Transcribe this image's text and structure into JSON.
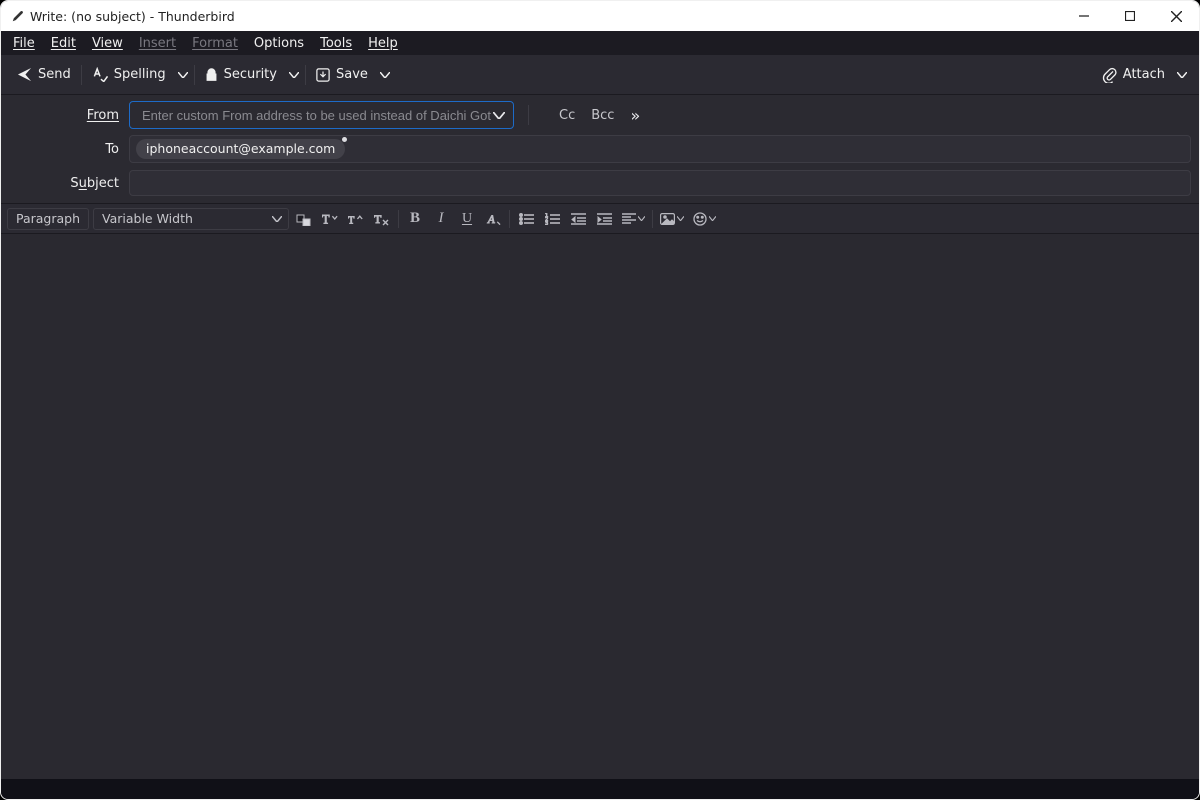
{
  "title": "Write: (no subject) - Thunderbird",
  "menubar": {
    "file": "File",
    "edit": "Edit",
    "view": "View",
    "insert": "Insert",
    "format": "Format",
    "options": "Options",
    "tools": "Tools",
    "help": "Help"
  },
  "toolbar": {
    "send": "Send",
    "spelling": "Spelling",
    "security": "Security",
    "save": "Save",
    "attach": "Attach"
  },
  "fields": {
    "from_label": "From",
    "from_placeholder": "Enter custom From address to be used instead of Daichi Goto",
    "from_value": "",
    "cc_label": "Cc",
    "bcc_label": "Bcc",
    "to_label": "To",
    "to_chip": "iphoneaccount@example.com",
    "subject_label_before": "S",
    "subject_label_underlined": "u",
    "subject_label_after": "bject",
    "subject_value": ""
  },
  "format": {
    "paragraph": "Paragraph",
    "font": "Variable Width"
  }
}
